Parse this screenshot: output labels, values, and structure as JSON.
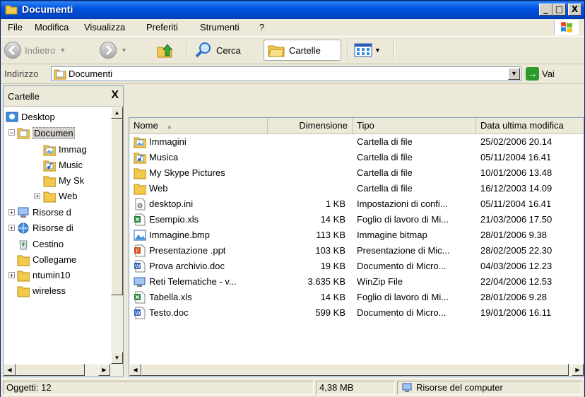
{
  "window": {
    "title": "Documenti",
    "buttons": {
      "minimize": "_",
      "maximize": "□",
      "close": "X"
    }
  },
  "menu": [
    "File",
    "Modifica",
    "Visualizza",
    "Preferiti",
    "Strumenti",
    "?"
  ],
  "toolbar": {
    "back_label": "Indietro",
    "search_label": "Cerca",
    "folders_label": "Cartelle"
  },
  "address": {
    "label": "Indirizzo",
    "value": "Documenti",
    "go_label": "Vai"
  },
  "folders_pane": {
    "title": "Cartelle",
    "close": "X",
    "tree": [
      {
        "label": "Desktop",
        "level": 0,
        "icon": "desktop-icon",
        "expander": ""
      },
      {
        "label": "Documen",
        "level": 1,
        "icon": "documents-folder-icon",
        "expander": "−",
        "selected": true
      },
      {
        "label": "Immag",
        "level": 2,
        "icon": "pictures-folder-icon",
        "expander": ""
      },
      {
        "label": "Music",
        "level": 2,
        "icon": "music-folder-icon",
        "expander": ""
      },
      {
        "label": "My Sk",
        "level": 2,
        "icon": "folder-icon",
        "expander": ""
      },
      {
        "label": "Web",
        "level": 2,
        "icon": "folder-icon",
        "expander": "+"
      },
      {
        "label": "Risorse d",
        "level": 1,
        "icon": "computer-icon",
        "expander": "+"
      },
      {
        "label": "Risorse di",
        "level": 1,
        "icon": "network-icon",
        "expander": "+"
      },
      {
        "label": "Cestino",
        "level": 1,
        "icon": "recycle-bin-icon",
        "expander": ""
      },
      {
        "label": "Collegame",
        "level": 1,
        "icon": "folder-icon",
        "expander": ""
      },
      {
        "label": "ntumin10",
        "level": 1,
        "icon": "folder-icon",
        "expander": "+"
      },
      {
        "label": "wireless",
        "level": 1,
        "icon": "folder-icon",
        "expander": ""
      }
    ]
  },
  "file_list": {
    "columns": [
      "Nome",
      "Dimensione",
      "Tipo",
      "Data ultima modifica"
    ],
    "rows": [
      {
        "name": "Immagini",
        "size": "",
        "type": "Cartella di file",
        "date": "25/02/2006 20.14",
        "icon": "pictures-folder-icon"
      },
      {
        "name": "Musica",
        "size": "",
        "type": "Cartella di file",
        "date": "05/11/2004 16.41",
        "icon": "music-folder-icon"
      },
      {
        "name": "My Skype Pictures",
        "size": "",
        "type": "Cartella di file",
        "date": "10/01/2006 13.48",
        "icon": "folder-icon"
      },
      {
        "name": "Web",
        "size": "",
        "type": "Cartella di file",
        "date": "16/12/2003 14.09",
        "icon": "folder-icon"
      },
      {
        "name": "desktop.ini",
        "size": "1 KB",
        "type": "Impostazioni di confi...",
        "date": "05/11/2004 16.41",
        "icon": "settings-file-icon"
      },
      {
        "name": "Esempio.xls",
        "size": "14 KB",
        "type": "Foglio di lavoro di Mi...",
        "date": "21/03/2006 17.50",
        "icon": "excel-file-icon"
      },
      {
        "name": "Immagine.bmp",
        "size": "113 KB",
        "type": "Immagine bitmap",
        "date": "28/01/2006 9.38",
        "icon": "bitmap-file-icon"
      },
      {
        "name": "Presentazione .ppt",
        "size": "103 KB",
        "type": "Presentazione di Mic...",
        "date": "28/02/2005 22.30",
        "icon": "powerpoint-file-icon"
      },
      {
        "name": "Prova archivio.doc",
        "size": "19 KB",
        "type": "Documento di Micro...",
        "date": "04/03/2006 12.23",
        "icon": "word-file-icon"
      },
      {
        "name": "Reti Telematiche - v...",
        "size": "3.635 KB",
        "type": "WinZip File",
        "date": "22/04/2006 12.53",
        "icon": "winzip-file-icon"
      },
      {
        "name": "Tabella.xls",
        "size": "14 KB",
        "type": "Foglio di lavoro di Mi...",
        "date": "28/01/2006 9.28",
        "icon": "excel-file-icon"
      },
      {
        "name": "Testo.doc",
        "size": "599 KB",
        "type": "Documento di Micro...",
        "date": "19/01/2006 16.11",
        "icon": "word-file-icon"
      }
    ]
  },
  "status": {
    "objects": "Oggetti: 12",
    "size": "4,38 MB",
    "location": "Risorse del computer"
  },
  "colors": {
    "titlebar": "#0054e3",
    "chrome": "#ece9d8",
    "border": "#7f9db9",
    "folder": "#f2c94c"
  }
}
